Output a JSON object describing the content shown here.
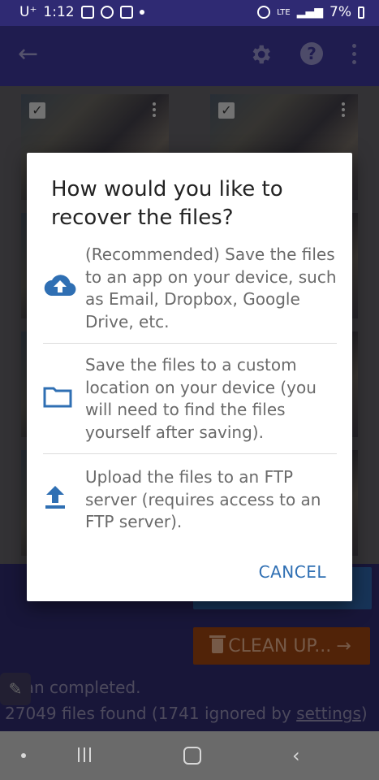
{
  "status_bar": {
    "carrier": "U⁺",
    "time": "1:12",
    "network": "LTE",
    "battery": "7%"
  },
  "dialog": {
    "title": "How would you like to recover the files?",
    "options": [
      {
        "icon": "cloud-upload-icon",
        "text": "(Recommended) Save the files to an app on your device, such as Email, Dropbox, Google Drive, etc."
      },
      {
        "icon": "folder-icon",
        "text": "Save the files to a custom location on your device (you will need to find the files yourself after saving)."
      },
      {
        "icon": "upload-icon",
        "text": "Upload the files to an FTP server (requires access to an FTP server)."
      }
    ],
    "cancel_label": "CANCEL"
  },
  "bottom": {
    "clean_up_label": "CLEAN UP...",
    "scan_status": "Scan completed.",
    "files_found": "27049 files found (1741 ignored by ",
    "settings_link": "settings",
    "files_found_suffix": ")"
  },
  "colors": {
    "accent": "#2f6fb3",
    "appbar": "#3a3390",
    "clean_up": "#94400f"
  }
}
